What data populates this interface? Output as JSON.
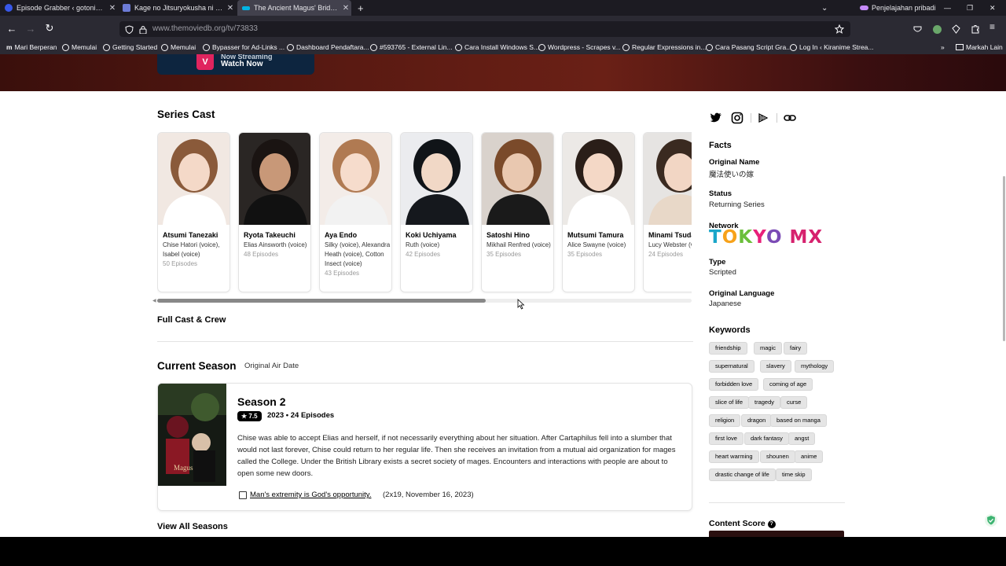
{
  "browser": {
    "tabs": [
      {
        "title": "Episode Grabber ‹ gotonime —",
        "active": false,
        "icon_color": "#3858e9"
      },
      {
        "title": "Kage no Jitsuryokusha ni Narita",
        "active": false,
        "icon_color": "#6c7bd6"
      },
      {
        "title": "The Ancient Magus' Bride (TV S",
        "active": true,
        "icon_color": "#01b4e4"
      }
    ],
    "private_label": "Penjelajahan pribadi",
    "url_host": "www.themoviedb.org",
    "url_path": "/tv/73833",
    "bookmarks": [
      "Mari Berperan",
      "Memulai",
      "Getting Started",
      "Memulai",
      "Bypasser for Ad-Links ...",
      "Dashboard Pendaftara...",
      "#593765 - External Lin...",
      "Cara Install Windows S...",
      "Wordpress - Scrapes v...",
      "Regular Expressions in...",
      "Cara Pasang Script Gra...",
      "Log In ‹ Kiranime Strea..."
    ],
    "other_bookmarks": "Markah Lain"
  },
  "hero": {
    "stream_line1": "Now Streaming",
    "stream_line2": "Watch Now",
    "stream_logo": "V"
  },
  "series_cast": {
    "heading": "Series Cast",
    "cast": [
      {
        "name": "Atsumi Tanezaki",
        "role": "Chise Hatori (voice), Isabel (voice)",
        "episodes": "50 Episodes",
        "photo_bg": "#f1e8e2",
        "hair": "#8a5a3a",
        "skin": "#f4d9c8",
        "cloth": "#ffffff"
      },
      {
        "name": "Ryota Takeuchi",
        "role": "Elias Ainsworth (voice)",
        "episodes": "48 Episodes",
        "photo_bg": "#2a2624",
        "hair": "#1a1412",
        "skin": "#c89878",
        "cloth": "#111111"
      },
      {
        "name": "Aya Endo",
        "role": "Silky (voice), Alexandra Heath (voice), Cotton Insect (voice)",
        "episodes": "43 Episodes",
        "photo_bg": "#f3ece8",
        "hair": "#b07a52",
        "skin": "#f6dccc",
        "cloth": "#f2f2f2"
      },
      {
        "name": "Koki Uchiyama",
        "role": "Ruth (voice)",
        "episodes": "42 Episodes",
        "photo_bg": "#ebecef",
        "hair": "#101418",
        "skin": "#f1d8c6",
        "cloth": "#15181d"
      },
      {
        "name": "Satoshi Hino",
        "role": "Mikhail Renfred (voice)",
        "episodes": "35 Episodes",
        "photo_bg": "#d9d2cc",
        "hair": "#7a4a2a",
        "skin": "#e9c8b0",
        "cloth": "#1a1a1a"
      },
      {
        "name": "Mutsumi Tamura",
        "role": "Alice Swayne (voice)",
        "episodes": "35 Episodes",
        "photo_bg": "#ece9e6",
        "hair": "#2a1e18",
        "skin": "#f4d8c6",
        "cloth": "#ffffff"
      },
      {
        "name": "Minami Tsuda",
        "role": "Lucy Webster (voice)",
        "episodes": "24 Episodes",
        "photo_bg": "#e6e4e2",
        "hair": "#3a2a20",
        "skin": "#f2d6c4",
        "cloth": "#e8d8c8"
      }
    ],
    "full_cast_link": "Full Cast & Crew"
  },
  "current_season": {
    "heading": "Current Season",
    "subheading": "Original Air Date",
    "title": "Season 2",
    "rating": "★ 7.5",
    "meta": "2023 • 24 Episodes",
    "description": "Chise was able to accept Elias and herself, if not necessarily everything about her situation. After Cartaphilus fell into a slumber that would not last forever, Chise could return to her regular life. Then she receives an invitation from a mutual aid organization for mages called the College. Under the British Library exists a secret society of mages. Encounters and interactions with people are about to open some new doors.",
    "episode_title": "Man's extremity is God's opportunity.",
    "episode_meta": "(2x19, November 16, 2023)",
    "view_all": "View All Seasons"
  },
  "sidebar": {
    "facts_heading": "Facts",
    "original_name_label": "Original Name",
    "original_name": "魔法使いの嫁",
    "status_label": "Status",
    "status": "Returning Series",
    "network_label": "Network",
    "network_logo": "TOKYO MX",
    "type_label": "Type",
    "type": "Scripted",
    "language_label": "Original Language",
    "language": "Japanese",
    "keywords_heading": "Keywords",
    "keywords": [
      "friendship",
      "magic",
      "fairy",
      "supernatural",
      "slavery",
      "mythology",
      "forbidden love",
      "coming of age",
      "slice of life",
      "tragedy",
      "curse",
      "religion",
      "dragon",
      "based on manga",
      "first love",
      "dark fantasy",
      "angst",
      "heart warming",
      "shounen",
      "anime",
      "drastic change of life",
      "time skip"
    ],
    "content_score_label": "Content Score"
  }
}
